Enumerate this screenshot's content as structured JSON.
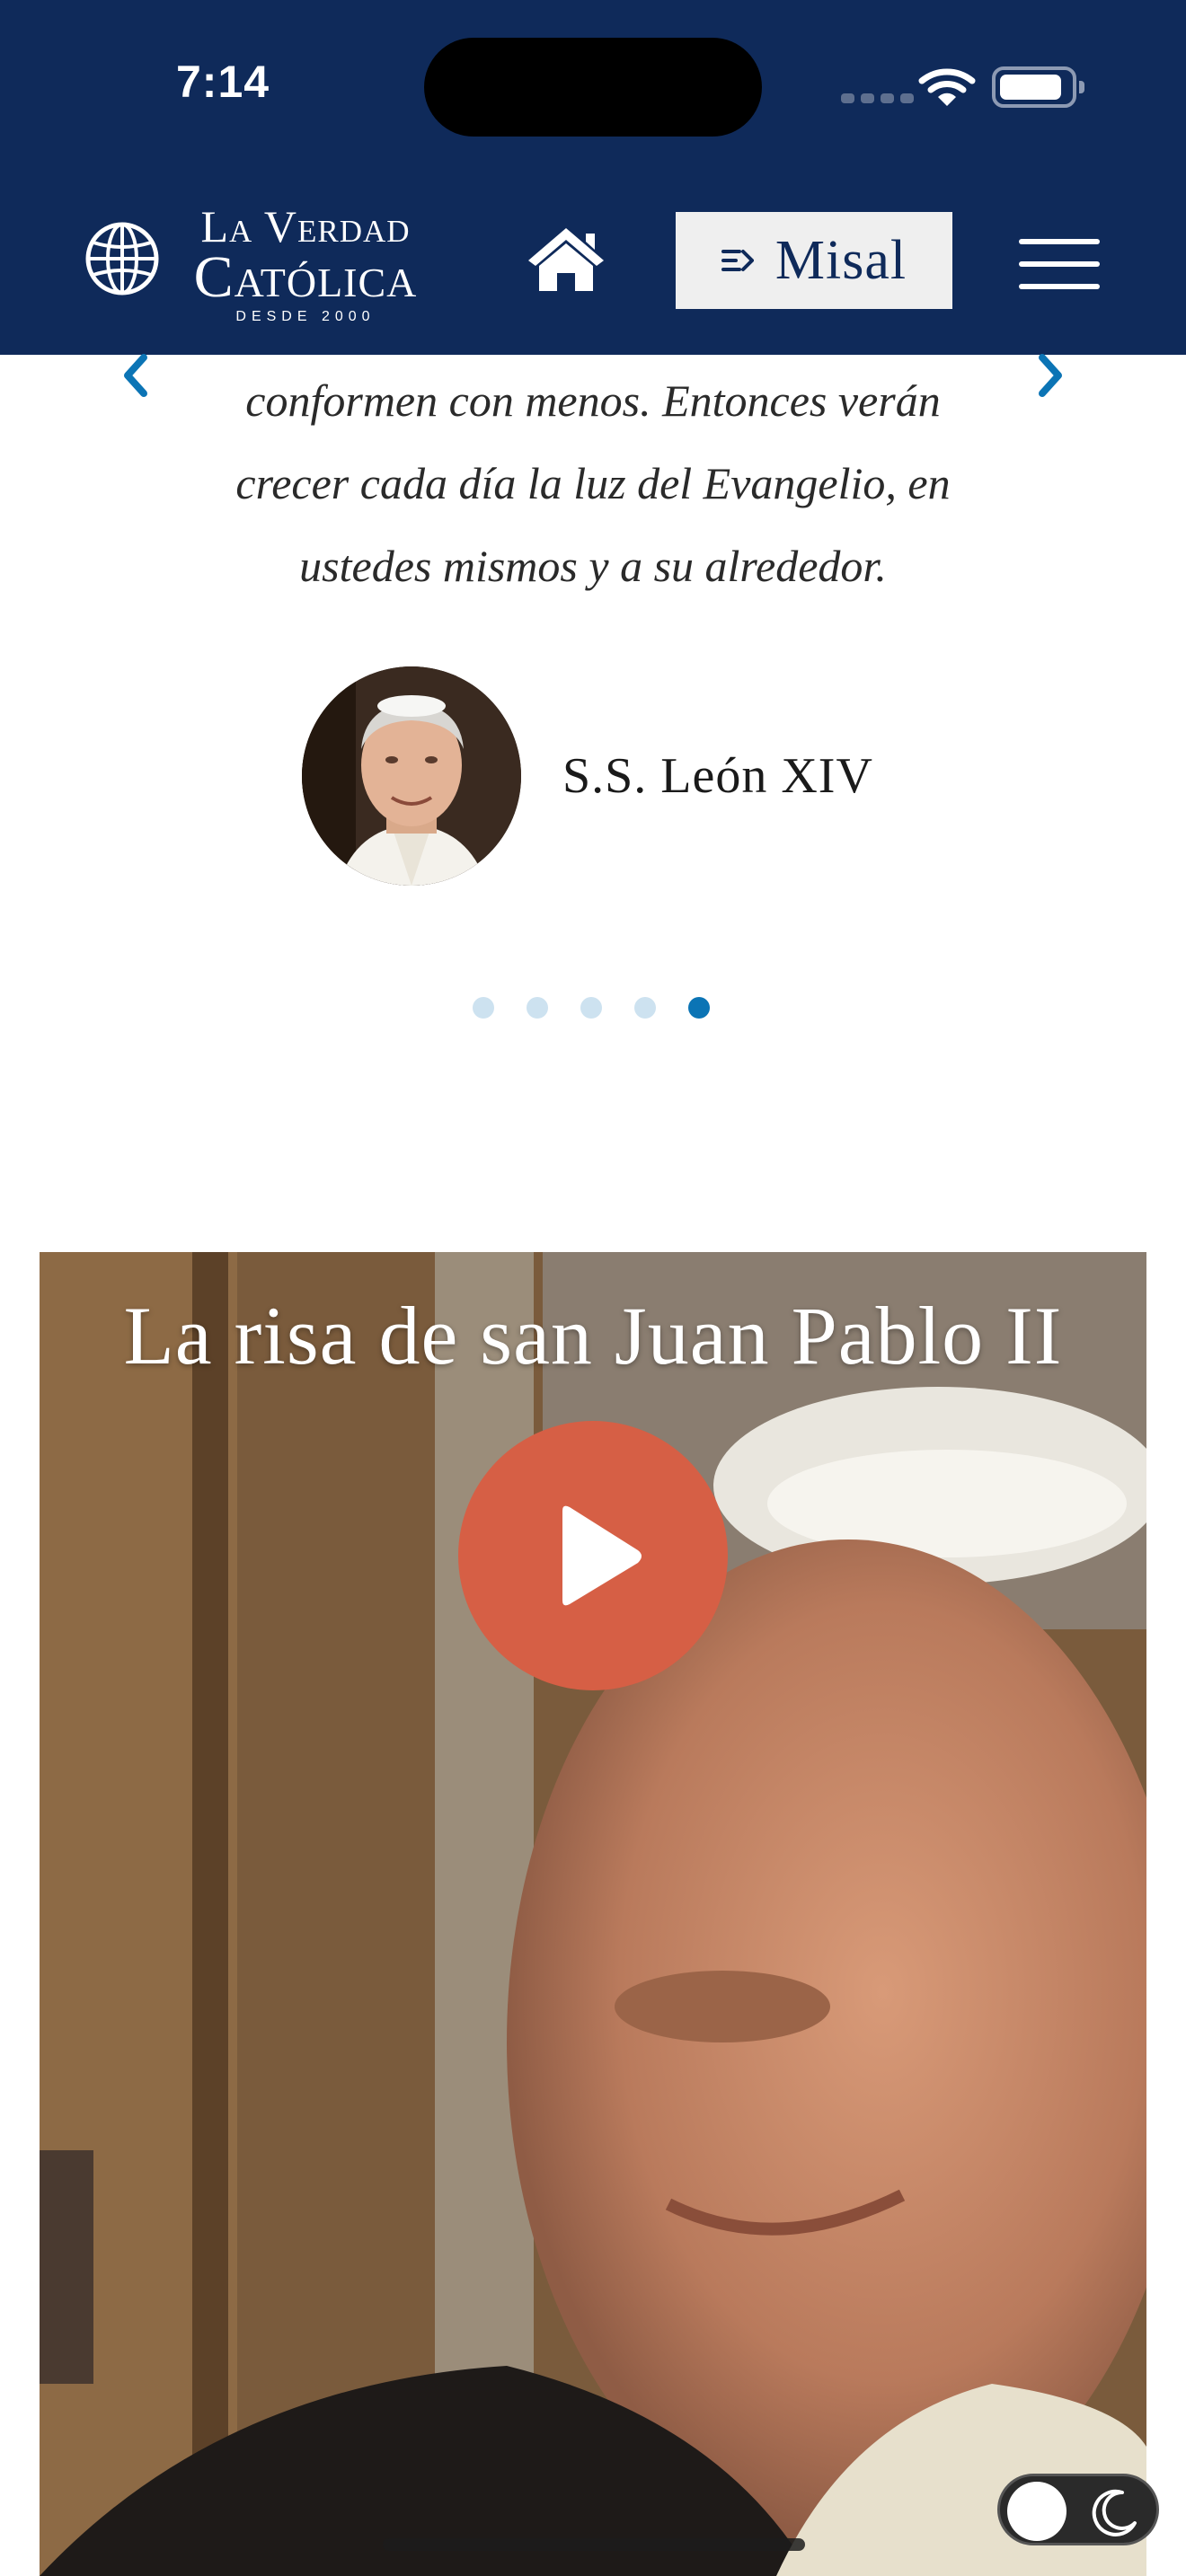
{
  "status_bar": {
    "time": "7:14"
  },
  "header": {
    "logo": {
      "line1": "La Verdad",
      "line2": "Católica",
      "line3": "DESDE 2000"
    },
    "misal_label": "Misal"
  },
  "quote": {
    "lines": [
      "conformen con menos. Entonces verán",
      "crecer cada día la luz del Evangelio, en",
      "ustedes mismos y a su alrededor."
    ],
    "author": "S.S. León XIV",
    "carousel": {
      "count": 5,
      "active_index": 4
    }
  },
  "video": {
    "title": "La risa de san Juan Pablo II"
  },
  "colors": {
    "header_bg": "#0f2a5a",
    "accent": "#0b74b5",
    "play_button": "#d65f45",
    "dot_inactive": "#cde2f0"
  },
  "icons": [
    "globe-icon",
    "home-icon",
    "misal-icon",
    "menu-icon",
    "chevron-left-icon",
    "chevron-right-icon",
    "play-icon",
    "moon-icon",
    "wifi-icon",
    "battery-icon"
  ]
}
